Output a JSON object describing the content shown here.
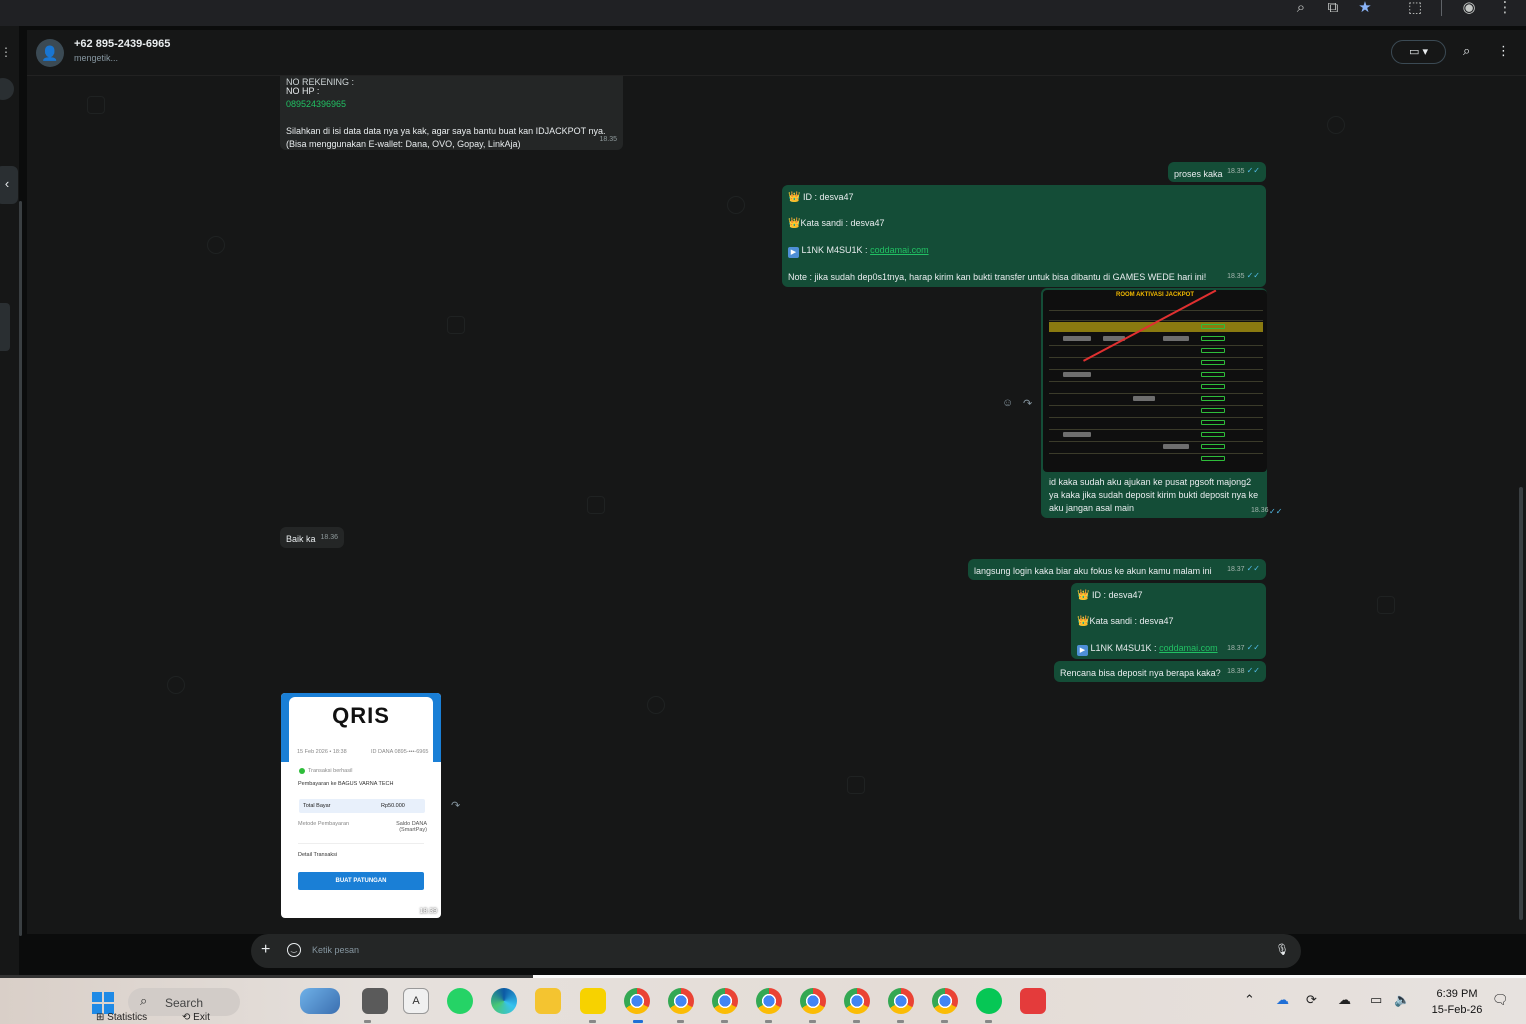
{
  "contact": {
    "name": "+62 895-2439-6965",
    "status": "mengetik..."
  },
  "messages": {
    "m1": {
      "line_top": "NO REKENING :",
      "hp_label": "NO HP :",
      "hp_value": "089524396965",
      "body1": "Silahkan di isi data data nya ya kak, agar saya bantu buat kan IDJACKPOT nya.",
      "body2": "(Bisa menggunakan E-wallet: Dana, OVO, Gopay, LinkAja)",
      "time": "18.35"
    },
    "m2": {
      "text": "proses kaka",
      "time": "18.35"
    },
    "m3": {
      "id_line": "ID :  desva47",
      "pw_line": "Kata sandi : desva47",
      "link_label": "L1NK M4SU1K :",
      "link": "coddamai.com",
      "note": "Note : jika sudah dep0s1tnya, harap kirim kan bukti transfer untuk bisa dibantu di GAMES WEDE hari ini!",
      "time": "18.35"
    },
    "m4": {
      "sheet_title": "ROOM AKTIVASI JACKPOT",
      "caption": "id kaka sudah aku ajukan ke pusat pgsoft majong2 ya kaka jika sudah deposit kirim bukti deposit nya ke aku jangan asal main",
      "time": "18.36"
    },
    "m5": {
      "text": "Baik ka",
      "time": "18.36"
    },
    "m6": {
      "text": "langsung login kaka biar aku fokus ke akun kamu malam ini",
      "time": "18.37"
    },
    "m7": {
      "id_line": "ID :  desva47",
      "pw_line": "Kata sandi : desva47",
      "link_label": "L1NK M4SU1K :",
      "link": "coddamai.com",
      "time": "18.37"
    },
    "m8": {
      "text": "Rencana bisa deposit nya berapa kaka?",
      "time": "18.38"
    },
    "m9": {
      "logo": "QRIS",
      "date_line": "15 Feb 2026 • 18:38",
      "dana_line": "ID DANA 0895-•••-6965",
      "status_line": "Transaksi berhasil",
      "payee": "Pembayaran ke BAGUS VARNA TECH",
      "total_label": "Total Bayar",
      "total_value": "Rp50.000",
      "method_label": "Metode Pembayaran",
      "method_value": "Saldo DANA (SmartPay)",
      "detail": "Detail Transaksi",
      "button": "BUAT PATUNGAN",
      "time": "18.39"
    }
  },
  "composer": {
    "placeholder": "Ketik pesan"
  },
  "taskbar": {
    "search": "Search",
    "statistics": "Statistics",
    "exit": "Exit",
    "time": "6:39 PM",
    "date": "15-Feb-26"
  },
  "colors": {
    "outgoing_bubble": "#144d37",
    "incoming_bubble": "#242626",
    "chat_bg": "#161717",
    "link": "#21c063"
  }
}
